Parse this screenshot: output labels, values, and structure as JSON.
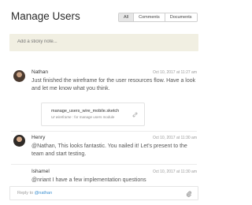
{
  "header": {
    "title": "Manage Users",
    "tabs": [
      "All",
      "Comments",
      "Documents"
    ],
    "active_tab": "All"
  },
  "sticky_note": {
    "placeholder": "Add a sticky note..."
  },
  "comments": [
    {
      "author": "Nathan",
      "date": "Oct 10, 2017 at 11:27 am",
      "text": "Just finished the wireframe for the user resources flow. Have a look and let me know what you think.",
      "attachment": {
        "filename": "manage_users_wire_mobile.sketch",
        "type_label": "UI wireframe",
        "description": "for manage users module",
        "icon": "link-icon"
      }
    },
    {
      "author": "Henry",
      "date": "Oct 10, 2017 at 11:30 am",
      "text": "@Nathan, This looks fantastic. You nailed it! Let's present to the team and start testing."
    },
    {
      "author": "Ishamel",
      "date": "Oct 10, 2017 at 11:30 am",
      "text": "@nriant I have a few implementation questions"
    }
  ],
  "reply": {
    "prefix": "Reply to ",
    "mention": "@nathan",
    "icon": "paperclip-icon"
  },
  "colors": {
    "sticky_bg": "#f1efe2",
    "mention": "#3b8fd0",
    "active_tab": "#e6e6e6"
  }
}
